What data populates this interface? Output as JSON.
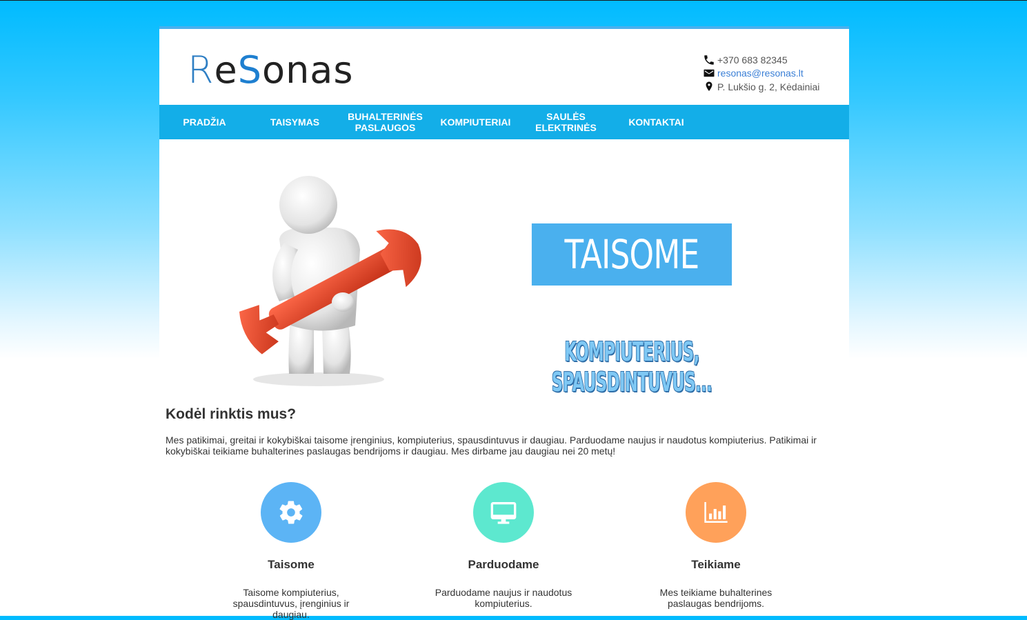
{
  "logo": {
    "part1": "R",
    "part2": "e",
    "part3": "S",
    "part4": "onas"
  },
  "contacts": {
    "phone": "+370 683 82345",
    "email": "resonas@resonas.lt",
    "address": "P. Lukšio g. 2, Kėdainiai"
  },
  "nav": {
    "items": [
      {
        "label": "PRADŽIA"
      },
      {
        "label": "TAISYMAS"
      },
      {
        "label": "BUHALTERINĖS PASLAUGOS"
      },
      {
        "label": "KOMPIUTERIAI"
      },
      {
        "label": "SAULĖS ELEKTRINĖS"
      },
      {
        "label": "KONTAKTAI"
      }
    ]
  },
  "hero": {
    "banner": "TAISOME",
    "subbanner": "KOMPIUTERIUS, SPAUSDINTUVUS..."
  },
  "why": {
    "title": "Kodėl rinktis mus?",
    "text": "Mes patikimai, greitai ir kokybiškai taisome įrenginius, kompiuterius, spausdintuvus ir daugiau. Parduodame naujus ir naudotus kompiuterius. Patikimai ir kokybiškai teikiame buhalterines paslaugas bendrijoms ir daugiau. Mes dirbame jau daugiau nei 20 metų!"
  },
  "features": [
    {
      "icon": "gear-icon",
      "color": "#5cb4f5",
      "title": "Taisome",
      "text": "Taisome kompiuterius, spausdintuvus, įrenginius ir daugiau."
    },
    {
      "icon": "monitor-icon",
      "color": "#5de8cf",
      "title": "Parduodame",
      "text": "Parduodame naujus ir naudotus kompiuterius."
    },
    {
      "icon": "bar-chart-icon",
      "color": "#ffa15a",
      "title": "Teikiame",
      "text": "Mes teikiame buhalterines paslaugas bendrijoms."
    }
  ],
  "colors": {
    "nav": "#13aee8",
    "accent": "#4ab0ee",
    "top_gradient": "#00bbff"
  }
}
